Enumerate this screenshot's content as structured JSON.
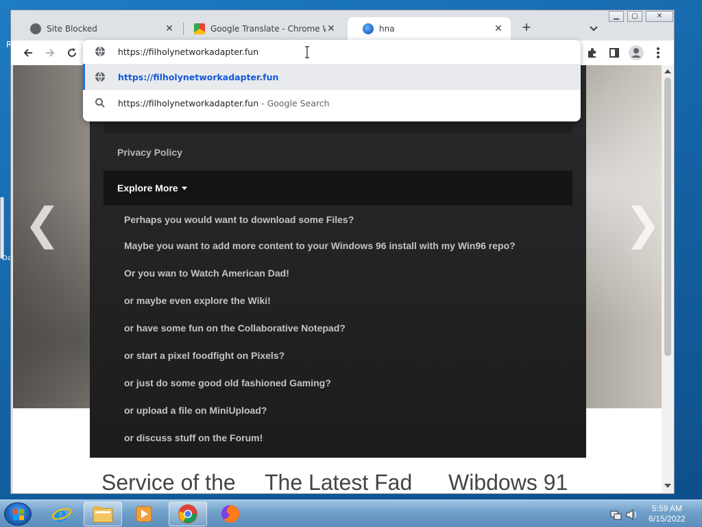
{
  "tabs": [
    {
      "title": "Site Blocked"
    },
    {
      "title": "Google Translate - Chrome Web"
    },
    {
      "title": "hna"
    }
  ],
  "toolbar": {
    "address_text": "https://filholynetworkadapter.fun"
  },
  "omnibox": {
    "suggestion_url": "https://filholynetworkadapter.fun",
    "search_query": "https://filholynetworkadapter.fun",
    "search_suffix": " - Google Search"
  },
  "page": {
    "nav_privacy": "Privacy Policy",
    "explore_label": "Explore More",
    "menu_items": [
      "Perhaps you would want to download some Files?",
      "Maybe you want to add more content to your Windows 96 install with my Win96 repo?",
      "Or you wan to Watch American Dad!",
      "or maybe even explore the Wiki!",
      "or have some fun on the Collaborative Notepad?",
      "or start a pixel foodfight on Pixels?",
      "or just do some good old fashioned Gaming?",
      "or upload a file on MiniUpload?",
      "or discuss stuff on the Forum!"
    ],
    "headings": [
      "Service of the",
      "The Latest Fad",
      "Wibdows 91"
    ],
    "prev_arrow": "❮",
    "next_arrow": "❯"
  },
  "desktop": {
    "letter_r": "R",
    "letter_da": "Da"
  },
  "taskbar": {
    "time": "5:59 AM",
    "date": "6/15/2022"
  },
  "colors": {
    "accent_blue": "#1a73e8",
    "link_blue": "#1558d6"
  }
}
